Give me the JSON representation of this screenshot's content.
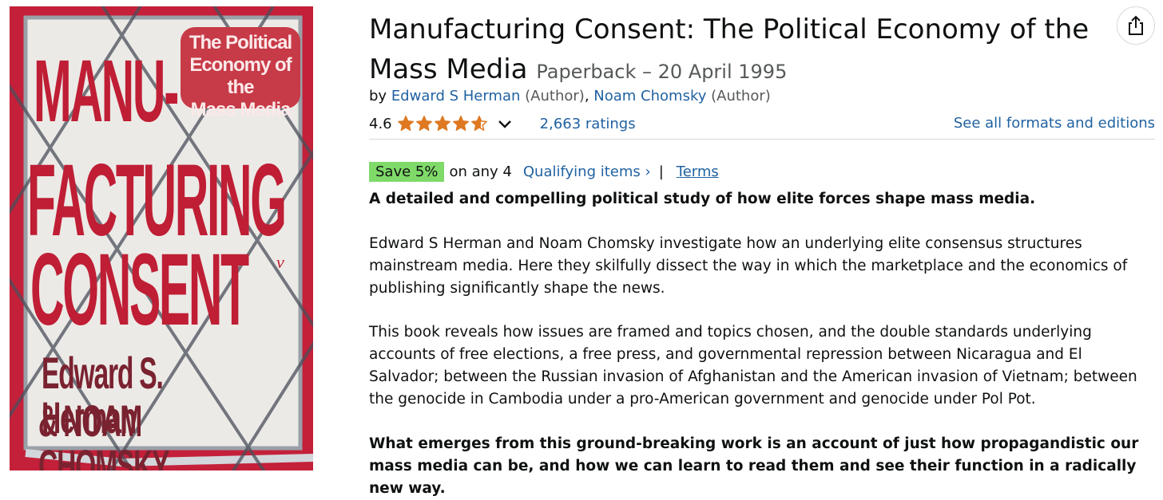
{
  "product": {
    "title": "Manufacturing Consent: The Political Economy of the Mass Media",
    "format_date": "Paperback – 20 April 1995",
    "by_prefix": "by",
    "authors": [
      {
        "name": "Edward S Herman",
        "role": "(Author)"
      },
      {
        "name": "Noam Chomsky",
        "role": "(Author)"
      }
    ],
    "rating_value": "4.6",
    "rating_fraction": 0.92,
    "ratings_count": "2,663 ratings",
    "see_all_formats": "See all formats and editions"
  },
  "promo": {
    "badge": "Save 5%",
    "text": "on any 4",
    "qualifying_link": "Qualifying items ›",
    "separator": "|",
    "terms_link": "Terms"
  },
  "description": {
    "headline": "A detailed and compelling political study of how elite forces shape mass media.",
    "para1": "Edward S Herman and Noam Chomsky investigate how an underlying elite consensus structures mainstream media. Here they skilfully dissect the way in which the marketplace and the economics of publishing significantly shape the news.",
    "para2": "This book reveals how issues are framed and topics chosen, and the double standards underlying accounts of free elections, a free press, and governmental repression between Nicaragua and El Salvador; between the Russian invasion of Afghanistan and the American invasion of Vietnam; between the genocide in Cambodia under a pro-American government and genocide under Pol Pot.",
    "para3": "What emerges from this ground-breaking work is an account of just how propagandistic our mass media can be, and how we can learn to read them and see their function in a radically new way."
  },
  "cover": {
    "line1": "MANU-",
    "line2": "FACTURING",
    "line3": "CONSENT",
    "subtitle": "The Political\nEconomy of the\nMass Media",
    "author1": "Edward S. Herman",
    "author2": "& NOAM CHOMSKY",
    "publisher_mark": "v"
  },
  "icons": {
    "share": "share-icon",
    "star": "star-icon",
    "chevron": "chevron-down-icon"
  },
  "colors": {
    "link": "#2162a1",
    "star": "#de7921",
    "save_badge": "#7fda69",
    "cover_red": "#bf1e35"
  }
}
